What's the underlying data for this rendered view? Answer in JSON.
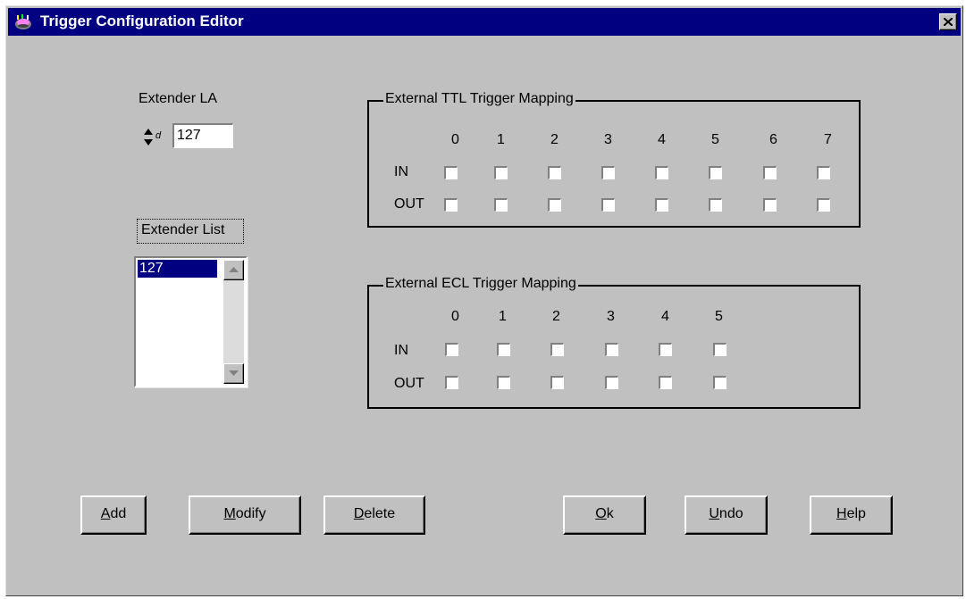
{
  "window": {
    "title": "Trigger Configuration Editor",
    "title_bar_color": "#000080",
    "face_color": "#c0c0c0"
  },
  "extender_la": {
    "label": "Extender LA",
    "radix_marker": "d",
    "value": "127"
  },
  "extender_list": {
    "label": "Extender List",
    "items": [
      "127"
    ],
    "selected": "127"
  },
  "ttl_mapping": {
    "title": "External TTL Trigger Mapping",
    "columns": [
      "0",
      "1",
      "2",
      "3",
      "4",
      "5",
      "6",
      "7"
    ],
    "rows": [
      {
        "label": "IN",
        "checked": [
          false,
          false,
          false,
          false,
          false,
          false,
          false,
          false
        ]
      },
      {
        "label": "OUT",
        "checked": [
          false,
          false,
          false,
          false,
          false,
          false,
          false,
          false
        ]
      }
    ]
  },
  "ecl_mapping": {
    "title": "External ECL Trigger Mapping",
    "columns": [
      "0",
      "1",
      "2",
      "3",
      "4",
      "5"
    ],
    "rows": [
      {
        "label": "IN",
        "checked": [
          false,
          false,
          false,
          false,
          false,
          false
        ]
      },
      {
        "label": "OUT",
        "checked": [
          false,
          false,
          false,
          false,
          false,
          false
        ]
      }
    ]
  },
  "buttons": {
    "add": {
      "mnemonic": "A",
      "rest": "dd"
    },
    "modify": {
      "mnemonic": "M",
      "rest": "odify"
    },
    "delete": {
      "mnemonic": "D",
      "rest": "elete"
    },
    "ok": {
      "mnemonic": "O",
      "rest": "k"
    },
    "undo": {
      "mnemonic": "U",
      "rest": "ndo"
    },
    "help": {
      "mnemonic": "H",
      "rest": "elp"
    }
  },
  "icons": [
    "app-icon",
    "close-icon",
    "spin-up-icon",
    "spin-down-icon",
    "scroll-up-icon",
    "scroll-down-icon"
  ]
}
